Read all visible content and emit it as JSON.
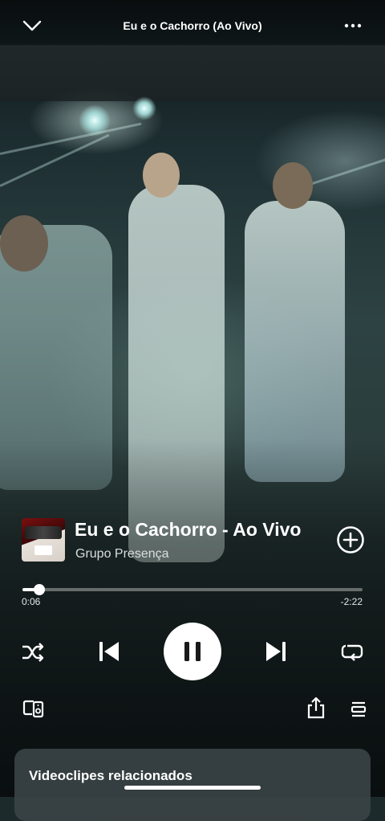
{
  "header": {
    "title": "Eu e o Cachorro (Ao Vivo)"
  },
  "track": {
    "title": "Eu e o Cachorro - Ao Vivo",
    "artist": "Grupo Presença",
    "cover_icon": "album-cover"
  },
  "playback": {
    "elapsed": "0:06",
    "remaining": "-2:22",
    "progress_fraction": 0.05,
    "state": "playing"
  },
  "controls": {
    "shuffle_icon": "shuffle-icon",
    "previous_icon": "skip-previous-icon",
    "pause_icon": "pause-icon",
    "next_icon": "skip-next-icon",
    "repeat_icon": "repeat-icon",
    "devices_icon": "connect-devices-icon",
    "share_icon": "share-icon",
    "queue_icon": "queue-icon"
  },
  "related": {
    "title": "Videoclipes relacionados"
  },
  "colors": {
    "accent": "#ffffff",
    "card_background": "#3a4244"
  }
}
